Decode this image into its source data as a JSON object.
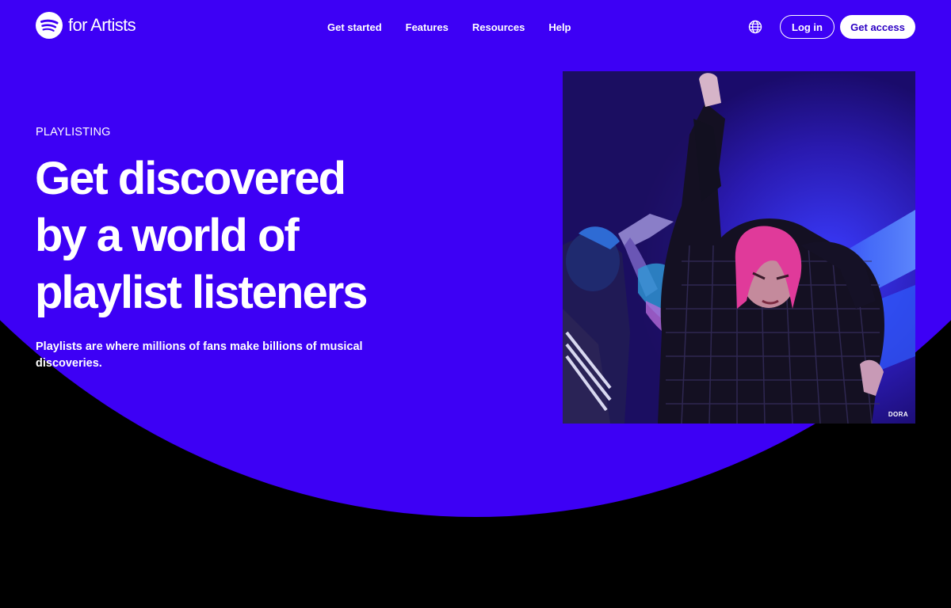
{
  "brand": {
    "name": "for Artists",
    "icon": "spotify-logo-icon"
  },
  "nav": {
    "items": [
      {
        "label": "Get started"
      },
      {
        "label": "Features"
      },
      {
        "label": "Resources"
      },
      {
        "label": "Help"
      }
    ]
  },
  "header": {
    "language_icon": "globe-icon",
    "login_label": "Log in",
    "access_label": "Get access"
  },
  "hero": {
    "eyebrow": "PLAYLISTING",
    "headline_line1": "Get discovered",
    "headline_line2": "by a world of",
    "headline_line3": "playlist listeners",
    "subtext": "Playlists are where millions of fans make billions of musical discoveries.",
    "photo_credit": "DORA"
  },
  "colors": {
    "hero_background": "#3d00f5",
    "page_background": "#000000",
    "text": "#ffffff",
    "access_button_text": "#2c00c4"
  }
}
